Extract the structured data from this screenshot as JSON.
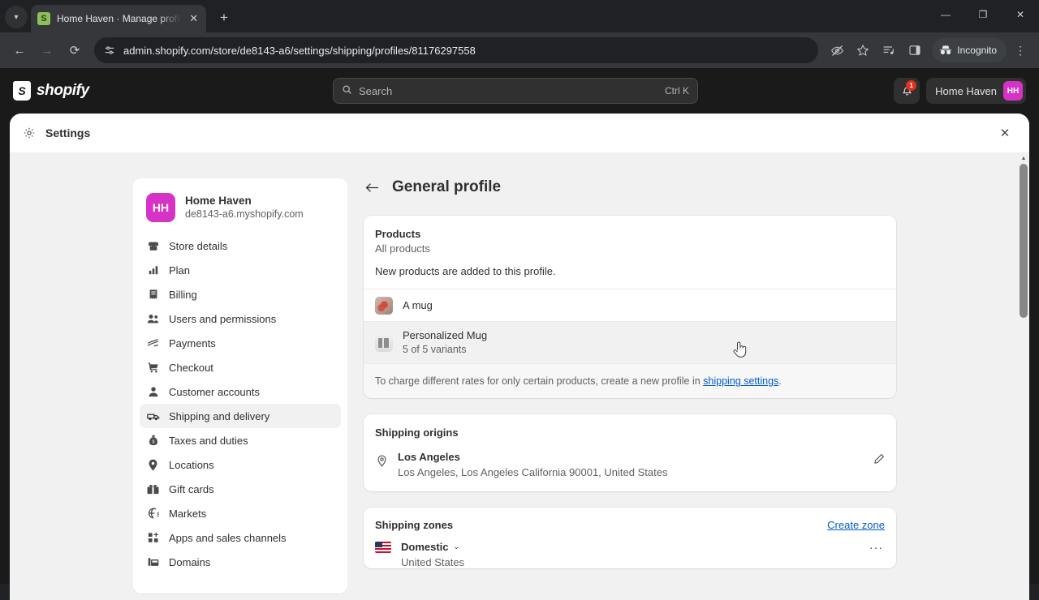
{
  "browser": {
    "tab": {
      "title": "Home Haven · Manage profile ·",
      "favicon": "shopify-favicon",
      "close": "✕"
    },
    "new_tab": "+",
    "window_controls": {
      "minimize": "—",
      "maximize": "❐",
      "close": "✕"
    },
    "nav": {
      "back": "←",
      "forward": "→",
      "reload": "⟳"
    },
    "url": "admin.shopify.com/store/de8143-a6/settings/shipping/profiles/81176297558",
    "site_info_icon": "tune-icon",
    "toolbar_icons": {
      "tracking_protection": "eye-off-icon",
      "bookmark": "star-icon",
      "reading_list": "split-list-icon",
      "side_panel": "side-panel-icon",
      "menu": "three-dot-menu-icon"
    },
    "incognito_label": "Incognito"
  },
  "shopify_topbar": {
    "logo_text": "shopify",
    "search": {
      "placeholder": "Search",
      "shortcut": "Ctrl K",
      "icon": "search-icon"
    },
    "notifications": {
      "icon": "bell-icon",
      "count": "1"
    },
    "store": {
      "name": "Home Haven",
      "initials": "HH",
      "avatar_color": "#d633c6"
    }
  },
  "modal": {
    "title": "Settings",
    "gear_icon": "gear-icon",
    "close_label": "✕"
  },
  "sidebar": {
    "store": {
      "initials": "HH",
      "name": "Home Haven",
      "domain": "de8143-a6.myshopify.com"
    },
    "items": [
      {
        "label": "Store details",
        "icon": "store-icon",
        "active": false
      },
      {
        "label": "Plan",
        "icon": "chart-bar-icon",
        "active": false
      },
      {
        "label": "Billing",
        "icon": "receipt-icon",
        "active": false
      },
      {
        "label": "Users and permissions",
        "icon": "users-icon",
        "active": false
      },
      {
        "label": "Payments",
        "icon": "payments-icon",
        "active": false
      },
      {
        "label": "Checkout",
        "icon": "cart-icon",
        "active": false
      },
      {
        "label": "Customer accounts",
        "icon": "person-icon",
        "active": false
      },
      {
        "label": "Shipping and delivery",
        "icon": "truck-icon",
        "active": true
      },
      {
        "label": "Taxes and duties",
        "icon": "money-bag-icon",
        "active": false
      },
      {
        "label": "Locations",
        "icon": "location-pin-icon",
        "active": false
      },
      {
        "label": "Gift cards",
        "icon": "gift-card-icon",
        "active": false
      },
      {
        "label": "Markets",
        "icon": "globe-icon",
        "active": false
      },
      {
        "label": "Apps and sales channels",
        "icon": "apps-grid-icon",
        "active": false
      },
      {
        "label": "Domains",
        "icon": "domain-icon",
        "active": false
      }
    ]
  },
  "main": {
    "page_title": "General profile",
    "back_icon": "back-arrow-icon",
    "products_card": {
      "title": "Products",
      "subtitle": "All products",
      "note": "New products are added to this profile.",
      "rows": [
        {
          "name": "A mug",
          "variants": "",
          "thumb": "mug-red-thumb"
        },
        {
          "name": "Personalized Mug",
          "variants": "5 of 5 variants",
          "thumb": "mug-personalized-thumb"
        }
      ],
      "footer_prefix": "To charge different rates for only certain products, create a new profile in ",
      "footer_link": "shipping settings",
      "footer_suffix": "."
    },
    "origins_card": {
      "title": "Shipping origins",
      "pin_icon": "location-pin-icon",
      "edit_icon": "pencil-icon",
      "origin_name": "Los Angeles",
      "origin_address": "Los Angeles, Los Angeles California 90001, United States"
    },
    "zones_card": {
      "title": "Shipping zones",
      "create_zone": "Create zone",
      "zone_name": "Domestic",
      "zone_caret": "⌄",
      "zone_flag": "us-flag-icon",
      "zone_more": "···",
      "zone_country": "United States"
    }
  }
}
